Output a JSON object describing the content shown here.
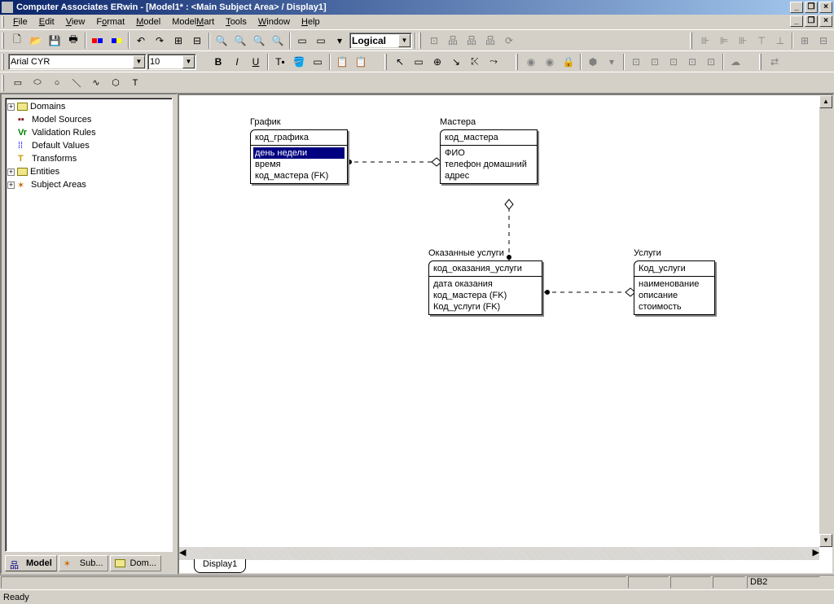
{
  "title": "Computer Associates ERwin - [Model1* : <Main Subject Area> / Display1]",
  "menus": [
    "File",
    "Edit",
    "View",
    "Format",
    "Model",
    "ModelMart",
    "Tools",
    "Window",
    "Help"
  ],
  "font_name": "Arial CYR",
  "font_size": "10",
  "view_selector": "Logical",
  "tree": [
    {
      "exp": "+",
      "label": "Domains",
      "icon": "folder"
    },
    {
      "exp": "",
      "label": "Model Sources",
      "icon": "ms"
    },
    {
      "exp": "",
      "label": "Validation Rules",
      "icon": "vr"
    },
    {
      "exp": "",
      "label": "Default Values",
      "icon": "dv"
    },
    {
      "exp": "",
      "label": "Transforms",
      "icon": "tr"
    },
    {
      "exp": "+",
      "label": "Entities",
      "icon": "folder"
    },
    {
      "exp": "+",
      "label": "Subject Areas",
      "icon": "sa"
    }
  ],
  "explorer_tabs": [
    {
      "icon": "model",
      "label": "Model"
    },
    {
      "icon": "subj",
      "label": "Sub..."
    },
    {
      "icon": "dom",
      "label": "Dom..."
    }
  ],
  "display_tab": "Display1",
  "entities": {
    "grafik": {
      "title": "График",
      "pk": [
        "код_графика"
      ],
      "attrs": [
        "день недели",
        "время",
        "код_мастера (FK)"
      ],
      "selected_attr_index": 0
    },
    "mastera": {
      "title": "Мастера",
      "pk": [
        "код_мастера"
      ],
      "attrs": [
        "ФИО",
        "телефон домашний",
        "адрес"
      ]
    },
    "okazannye": {
      "title": "Оказанные услуги",
      "pk": [
        "код_оказания_услуги"
      ],
      "attrs": [
        "дата оказания",
        "код_мастера (FK)",
        "Код_услуги (FK)"
      ]
    },
    "uslugi": {
      "title": "Услуги",
      "pk": [
        "Код_услуги"
      ],
      "attrs": [
        "наименование",
        "описание",
        "стоимость"
      ]
    }
  },
  "status_left": "Ready",
  "status_right": "DB2"
}
